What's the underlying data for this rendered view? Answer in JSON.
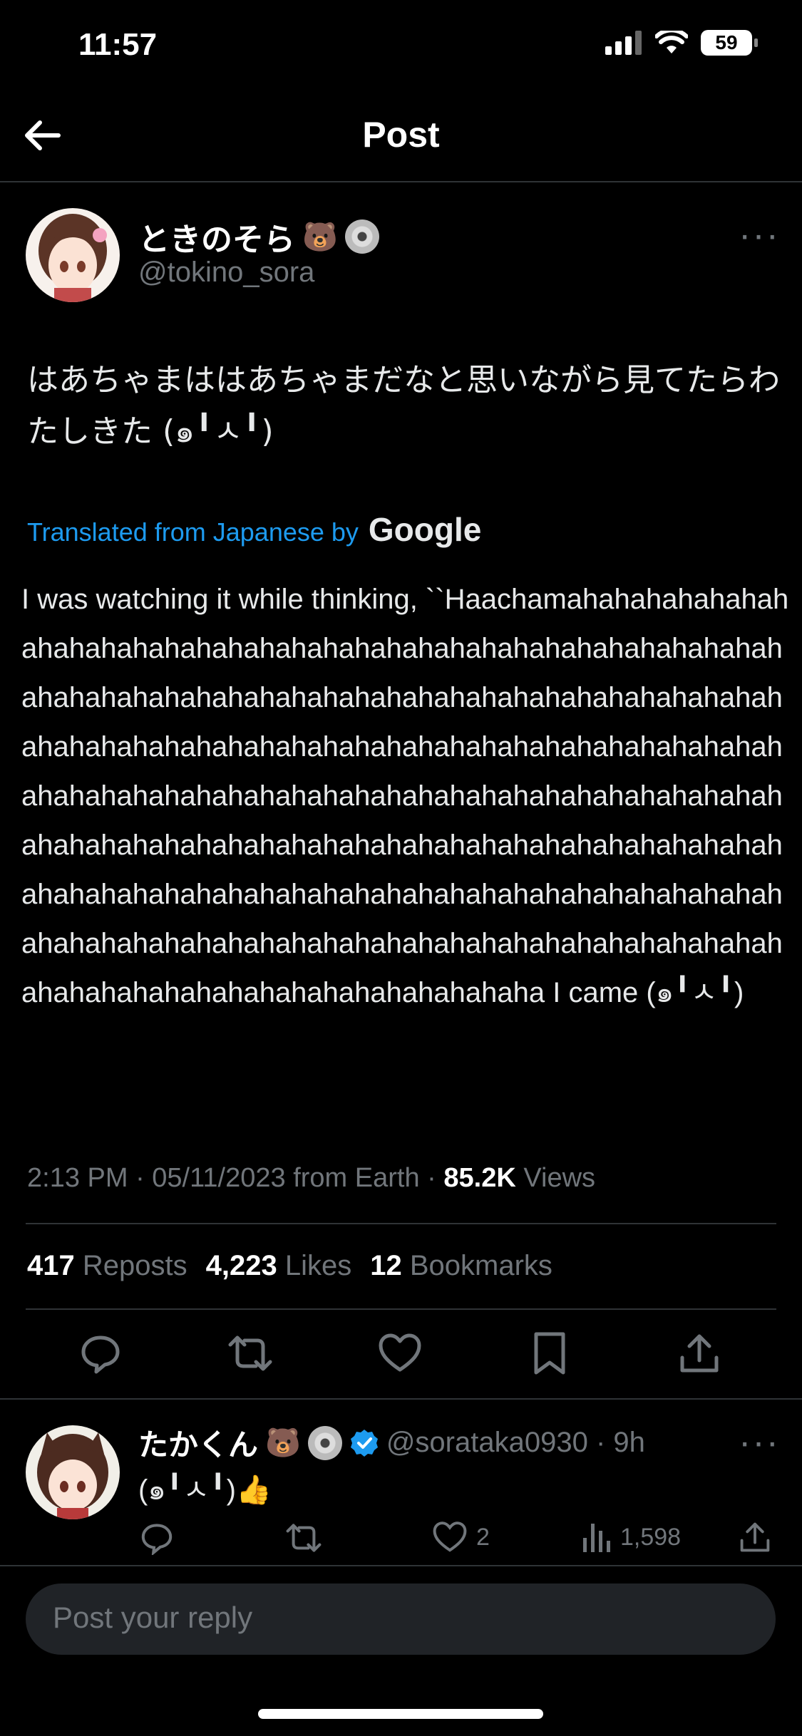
{
  "status_bar": {
    "time": "11:57",
    "battery": "59"
  },
  "header": {
    "title": "Post"
  },
  "post": {
    "name": "ときのそら",
    "handle": "@tokino_sora",
    "text": "はあちゃまははあちゃまだなと思いながら見てたらわたしきた (๑╹ㅅ╹)",
    "translated_label": "Translated from Japanese by",
    "google_label": "Google",
    "translation": "I was watching it while thinking, ``Haachamahahahahahahahahahahahahahahahahahahahahahahahahahahahahahahahahahahahahahahahahahahahahahahahahahahahahahahahahahahahahahahahahahahahahahahahahahahahahahahahahahahahahahahahahahahahahahahahahahahahahahahahahahahahahahahahahahahahahahahahahahahahahahahahahahahahahahahahahahahahahahahahahahahahahahahahahahahahahahahahahahahahahahahahahahahahahahahahahahahahahahahahahahahahahahahaha I came (๑╹ㅅ╹)",
    "meta_prefix": "2:13 PM · 05/11/2023 from Earth ·",
    "views_count": "85.2K",
    "views_label": "Views",
    "reposts_count": "417",
    "reposts_label": "Reposts",
    "likes_count": "4,223",
    "likes_label": "Likes",
    "bookmarks_count": "12",
    "bookmarks_label": "Bookmarks"
  },
  "reply": {
    "name": "たかくん",
    "handle_time": "@sorataka0930 · 9h",
    "text": "(๑╹ㅅ╹)👍",
    "likes": "2",
    "views": "1,598"
  },
  "composer": {
    "placeholder": "Post your reply"
  },
  "icons": [
    "back-arrow-icon",
    "more-icon",
    "reply-icon",
    "repost-icon",
    "like-icon",
    "bookmark-icon",
    "share-icon",
    "views-icon",
    "verified-icon",
    "bear-emoji-icon",
    "disc-icon"
  ],
  "colors": {
    "accent": "#1d9bf0",
    "background": "#000000",
    "muted": "#71767b"
  }
}
